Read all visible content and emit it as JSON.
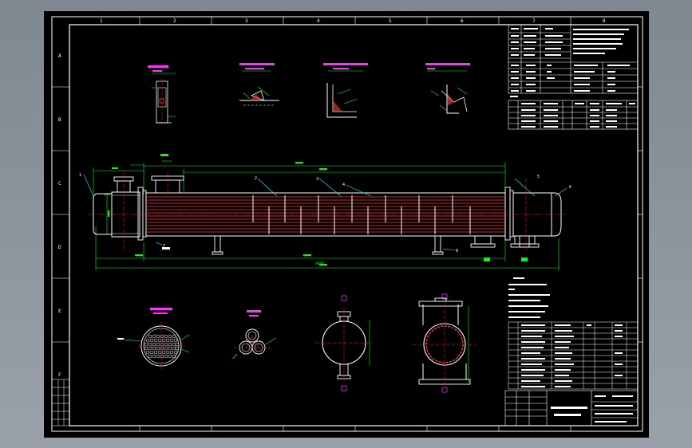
{
  "drawing": {
    "zones_top": [
      "1",
      "2",
      "3",
      "4",
      "5",
      "6",
      "7",
      "8"
    ],
    "zones_left": [
      "A",
      "B",
      "C",
      "D",
      "E",
      "F"
    ],
    "colors": {
      "background": "#000000",
      "frame": "#ffffff",
      "outline": "#ffffff",
      "dimension": "#00ff00",
      "tube": "#ff3b3b",
      "centerline": "#ff2020",
      "title": "#ff33ff",
      "callout": "#00ffff",
      "text": "#ffffff"
    }
  },
  "main_view": {
    "overall_dim": "9998",
    "callouts": [
      "1",
      "2",
      "3",
      "4",
      "5",
      "6",
      "7",
      "8"
    ]
  }
}
